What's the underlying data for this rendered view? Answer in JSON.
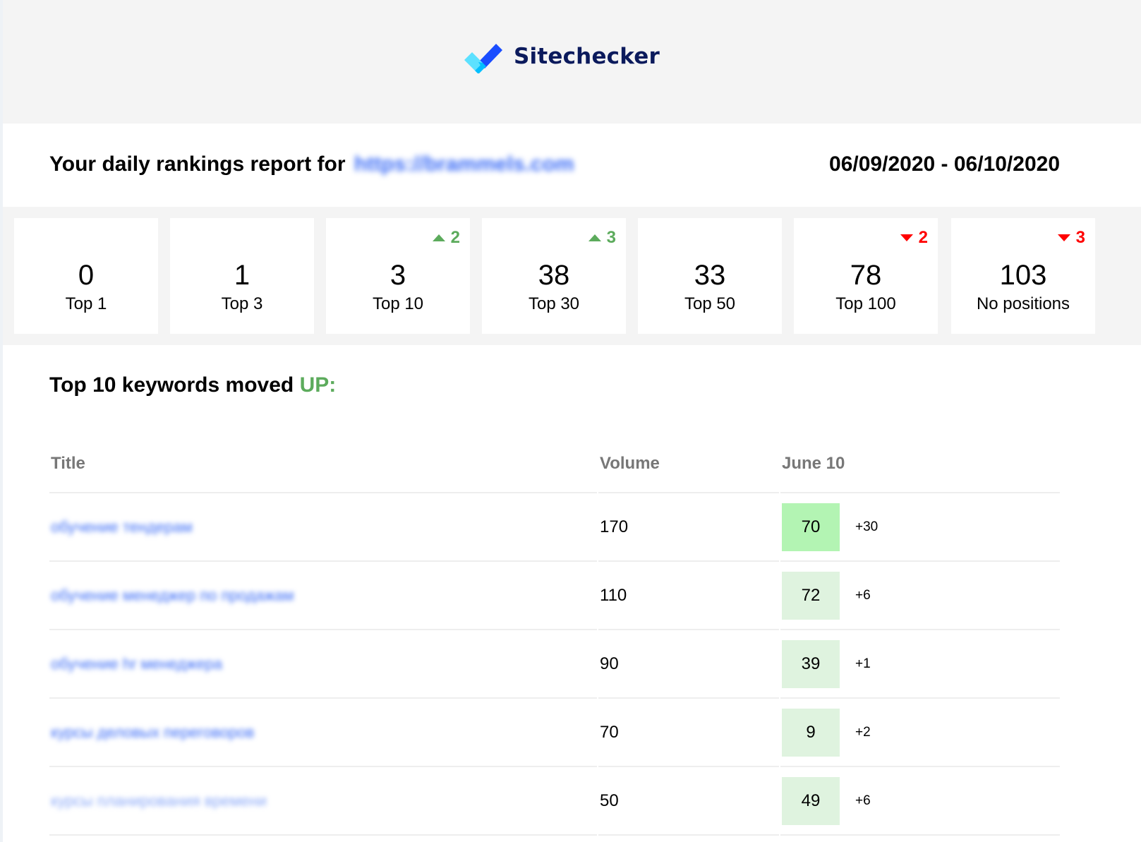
{
  "brand": {
    "name": "Sitechecker",
    "logo_icon": "checkmark-logo-icon",
    "colors": {
      "text": "#0b1a5c",
      "check_light": "#5ce1ff",
      "check_mid": "#00bfff",
      "check_dark": "#1a4dff"
    }
  },
  "report": {
    "title_prefix": "Your daily rankings report for",
    "site_url": "https://brammels.com",
    "date_range": "06/09/2020 - 06/10/2020"
  },
  "stats": [
    {
      "value": "0",
      "label": "Top 1",
      "change": null
    },
    {
      "value": "1",
      "label": "Top 3",
      "change": null
    },
    {
      "value": "3",
      "label": "Top 10",
      "change": {
        "direction": "up",
        "amount": "2"
      }
    },
    {
      "value": "38",
      "label": "Top 30",
      "change": {
        "direction": "up",
        "amount": "3"
      }
    },
    {
      "value": "33",
      "label": "Top 50",
      "change": null
    },
    {
      "value": "78",
      "label": "Top 100",
      "change": {
        "direction": "down",
        "amount": "2"
      }
    },
    {
      "value": "103",
      "label": "No positions",
      "change": {
        "direction": "down",
        "amount": "3"
      }
    }
  ],
  "colors": {
    "up": "#5cab5c",
    "down": "#ff0000",
    "link": "#3b6cf6",
    "pos_strong_bg": "#b3f4b3",
    "pos_light_bg": "#dff3df"
  },
  "keywords_section": {
    "title_prefix": "Top 10 keywords moved",
    "title_highlight": "UP:",
    "columns": {
      "title": "Title",
      "volume": "Volume",
      "date": "June 10"
    },
    "rows": [
      {
        "title": "обучение тендерам",
        "volume": "170",
        "position": "70",
        "delta": "+30",
        "highlight": "strong"
      },
      {
        "title": "обучение менеджер по продажам",
        "volume": "110",
        "position": "72",
        "delta": "+6",
        "highlight": "light"
      },
      {
        "title": "обучение hr менеджера",
        "volume": "90",
        "position": "39",
        "delta": "+1",
        "highlight": "light"
      },
      {
        "title": "курсы деловых переговоров",
        "volume": "70",
        "position": "9",
        "delta": "+2",
        "highlight": "light"
      },
      {
        "title": "курсы планирования времени",
        "volume": "50",
        "position": "49",
        "delta": "+6",
        "highlight": "light"
      }
    ]
  }
}
